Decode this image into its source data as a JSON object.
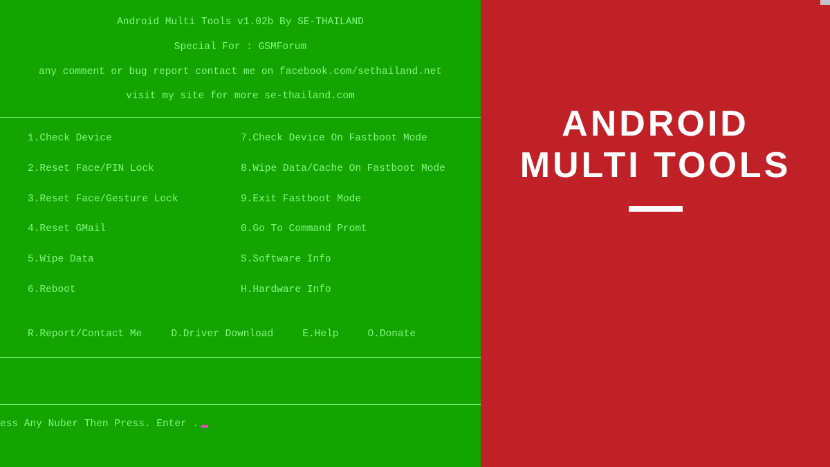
{
  "header": {
    "title": "Android Multi Tools v1.02b By SE-THAILAND",
    "special": "Special For : GSMForum",
    "contact": "any comment or bug report contact me on facebook.com/sethailand.net",
    "visit": "visit my site for more se-thailand.com"
  },
  "menu": {
    "left": [
      "1.Check Device",
      "2.Reset Face/PIN Lock",
      "3.Reset Face/Gesture Lock",
      "4.Reset GMail",
      "5.Wipe Data",
      "6.Reboot"
    ],
    "right": [
      "7.Check Device On Fastboot Mode",
      "8.Wipe Data/Cache On Fastboot Mode",
      "9.Exit Fastboot Mode",
      "0.Go To Command Promt",
      "S.Software Info",
      "H.Hardware Info"
    ],
    "bottom": [
      "R.Report/Contact Me",
      "D.Driver Download",
      "E.Help",
      "O.Donate"
    ]
  },
  "prompt": {
    "text": "ess Any Nuber Then Press. Enter  ."
  },
  "banner": {
    "line1": "ANDROID",
    "line2": "MULTI TOOLS"
  }
}
